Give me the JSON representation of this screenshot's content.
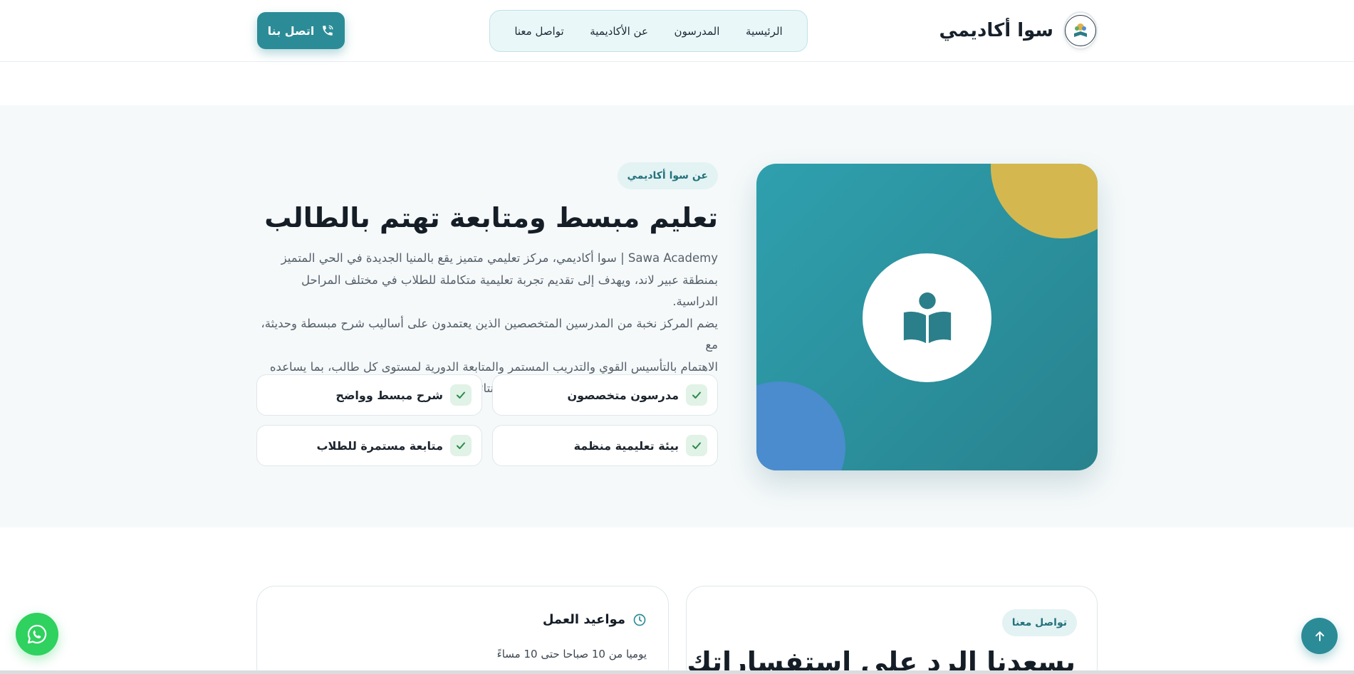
{
  "brand": {
    "name": "سوا أكاديمي"
  },
  "nav": {
    "items": [
      "الرئيسية",
      "المدرسون",
      "عن الأكاديمية",
      "تواصل معنا"
    ]
  },
  "header": {
    "call_button": "اتصل بنا"
  },
  "about": {
    "badge": "عن سوا أكاديمي",
    "title": "تعليم مبسط ومتابعة تهتم بالطالب",
    "description_lines": [
      "Sawa Academy | سوا أكاديمي، مركز تعليمي متميز يقع بالمنيا الجديدة في الحي المتميز",
      "بمنطقة عبير لاند، ويهدف إلى تقديم تجربة تعليمية متكاملة للطلاب في مختلف المراحل الدراسية.",
      "يضم المركز نخبة من المدرسين المتخصصين الذين يعتمدون على أساليب شرح مبسطة وحديثة، مع",
      "الاهتمام بالتأسيس القوي والتدريب المستمر والمتابعة الدورية لمستوى كل طالب، بما يساعده",
      "على تحسين تحصيله الدراسي وتحقيق أفضل النتائج."
    ],
    "features": [
      "مدرسون متخصصون",
      "شرح مبسط وواضح",
      "بيئة تعليمية منظمة",
      "متابعة مستمرة للطلاب"
    ]
  },
  "hours": {
    "title": "مواعيد العمل",
    "text": "يوميا من 10 صباحا حتى 10 مساءً"
  },
  "contact": {
    "badge": "تواصل معنا",
    "title": "يسعدنا الرد على استفساراتك"
  },
  "colors": {
    "primary": "#2b8c97",
    "accent_yellow": "#d4b84f",
    "accent_blue": "#4a8ccd",
    "whatsapp": "#2fd15f",
    "soft_bg": "#f5f9fa"
  },
  "icons": {
    "call": "phone-icon",
    "hero": "reading-person-icon",
    "feature": "check-icon",
    "hours": "clock-icon",
    "whatsapp": "whatsapp-icon",
    "to_top": "arrow-up-icon"
  }
}
